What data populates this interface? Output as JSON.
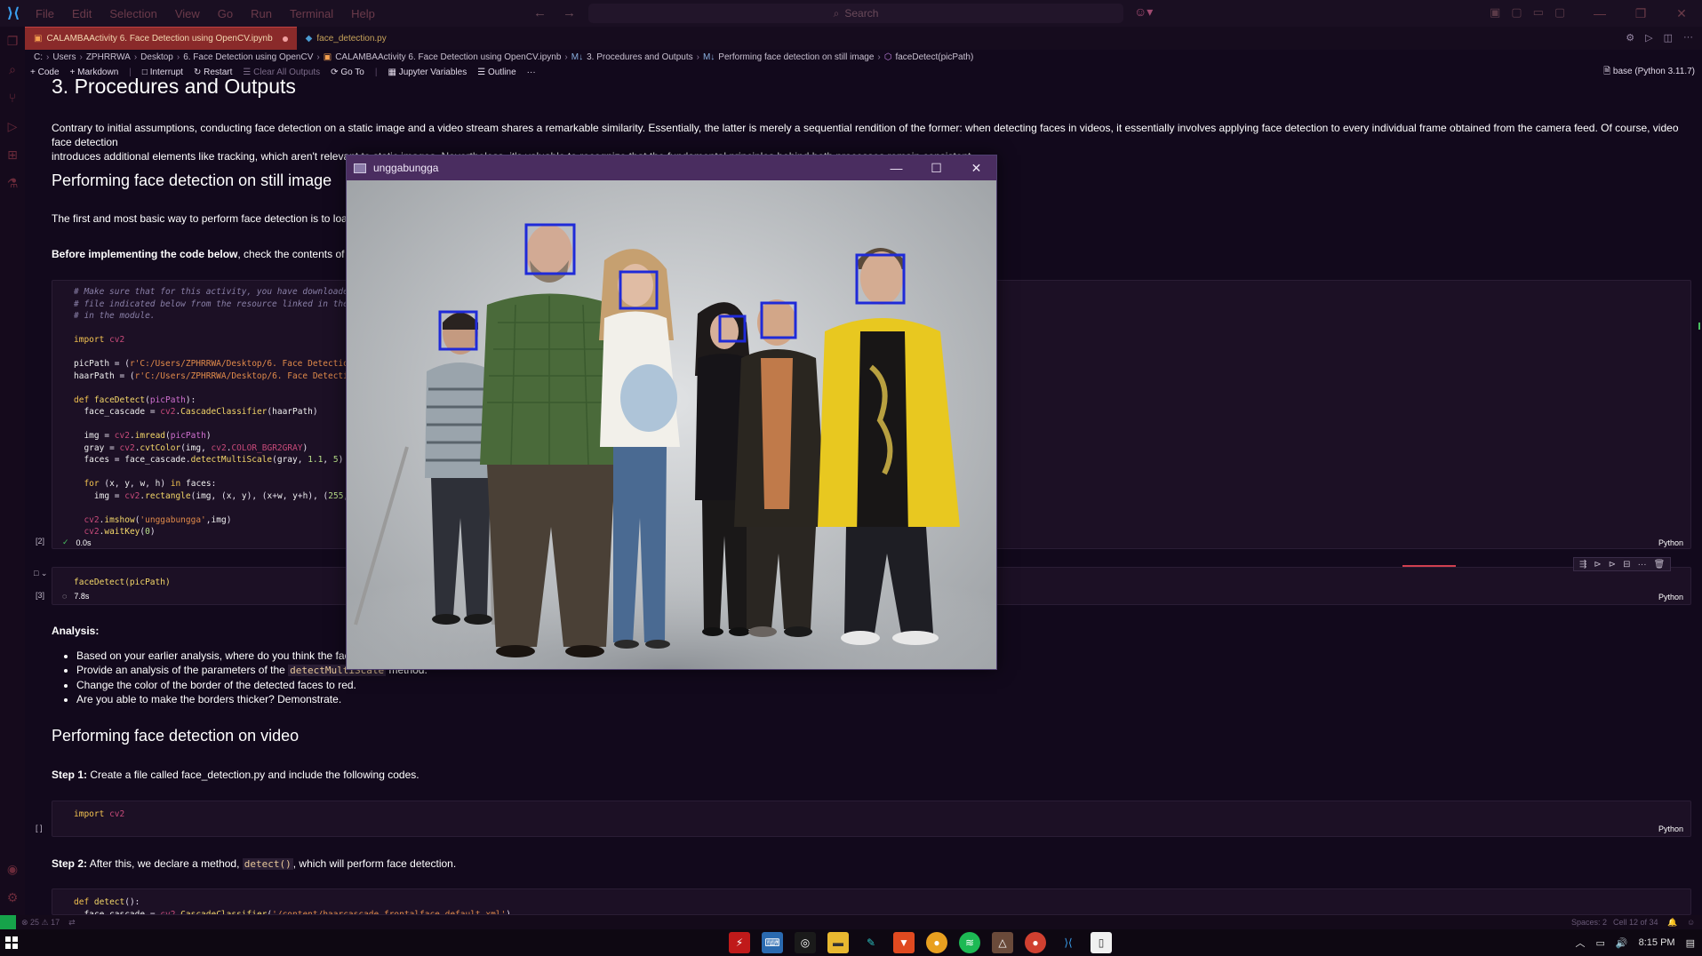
{
  "titlebar": {
    "menu": [
      "File",
      "Edit",
      "Selection",
      "View",
      "Go",
      "Run",
      "Terminal",
      "Help"
    ],
    "search_placeholder": "Search"
  },
  "tabs": [
    {
      "label": "CALAMBAActivity 6. Face Detection using OpenCV.ipynb",
      "active": true,
      "modified": true
    },
    {
      "label": "face_detection.py",
      "active": false
    }
  ],
  "breadcrumb": [
    "C:",
    "Users",
    "ZPHRRWA",
    "Desktop",
    "6. Face Detection using OpenCV",
    "CALAMBAActivity 6. Face Detection using OpenCV.ipynb",
    "3. Procedures and Outputs",
    "Performing face detection on still image",
    "faceDetect(picPath)"
  ],
  "toolbar": {
    "code": "+ Code",
    "markdown": "+ Markdown",
    "interrupt": "Interrupt",
    "restart": "Restart",
    "clear_outputs": "Clear All Outputs",
    "goto": "Go To",
    "jupyter_variables": "Jupyter Variables",
    "outline": "Outline",
    "more": "···",
    "kernel": "base (Python 3.11.7)"
  },
  "notebook": {
    "heading": "3. Procedures and Outputs",
    "intro_line1": "Contrary to initial assumptions, conducting face detection on a static image and a video stream shares a remarkable similarity. Essentially, the latter is merely a sequential rendition of the former: when detecting faces in videos, it essentially involves applying face detection to every individual frame obtained from the camera feed. Of course, video face detection",
    "intro_line2": "introduces additional elements like tracking, which aren't relevant to static images. Nevertheless, it's valuable to recognize that the fundamental principles behind both processes remain consistent.",
    "sub_still": "Performing face detection on still image",
    "still_para": "The first and most basic way to perform face detection is to load",
    "before_bold": "Before implementing the code below",
    "before_rest": ", check the contents of th",
    "cell2_number": "[2]",
    "cell2_time": "0.0s",
    "cell3_number": "[3]",
    "cell3_time": "7.8s",
    "cell3_code": "faceDetect(picPath)",
    "lang": "Python",
    "analysis_title": "Analysis:",
    "analysis_items": [
      "Based on your earlier analysis, where do you think the face",
      "Provide an analysis of the parameters of the",
      "Change the color of the border of the detected faces to red.",
      "Are you able to make the borders thicker? Demonstrate."
    ],
    "analysis_code": "detectMultiScale",
    "analysis_item2_tail": "method.",
    "sub_video": "Performing face detection on video",
    "step1_bold": "Step 1:",
    "step1_rest": "Create a file called face_detection.py and include the following codes.",
    "cell4_number": "[ ]",
    "cell4_code": "import cv2",
    "step2_bold": "Step 2:",
    "step2_pre": "After this, we declare a method,",
    "step2_code": "detect()",
    "step2_post": ", which will perform face detection.",
    "cell5_line1": "def detect():",
    "cell5_line2": "  face_cascade = cv2.CascadeClassifier('/content/haarcascade_frontalface_default.xml')"
  },
  "popup": {
    "title": "unggabungga",
    "faces_detected": 6
  },
  "statusbar": {
    "problems": "⊗ 25 ⚠ 17",
    "spaces": "Spaces: 2",
    "cell": "Cell 12 of 34"
  },
  "taskbar": {
    "time": "8:15 PM"
  },
  "colors": {
    "background": "#12091c",
    "tab_active": "#8a2a2a",
    "popup_title": "#4a2d60",
    "face_box": "#1f2ad8"
  }
}
